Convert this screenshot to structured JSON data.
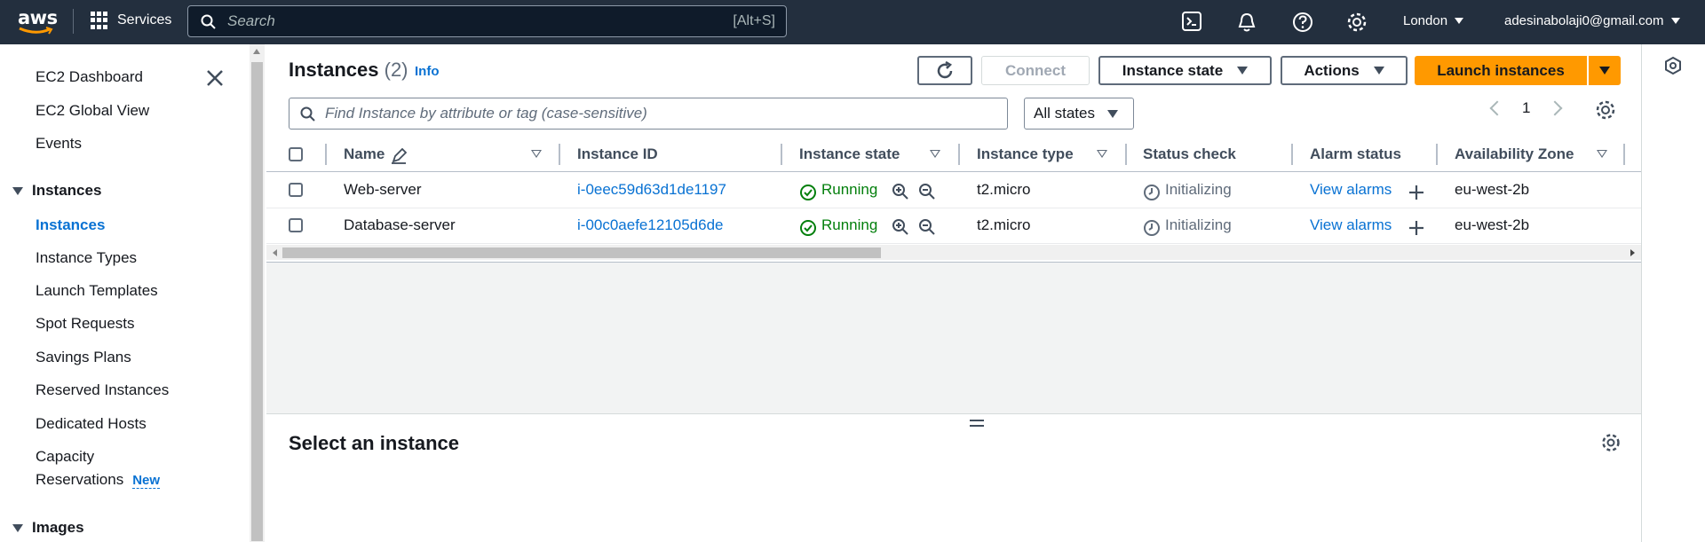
{
  "topnav": {
    "logo_text": "aws",
    "services_label": "Services",
    "search_placeholder": "Search",
    "search_shortcut": "[Alt+S]",
    "region": "London",
    "user": "adesinabolaji0@gmail.com"
  },
  "sidebar": {
    "items_top": [
      "EC2 Dashboard",
      "EC2 Global View",
      "Events"
    ],
    "section_instances": "Instances",
    "instances_items": [
      "Instances",
      "Instance Types",
      "Launch Templates",
      "Spot Requests",
      "Savings Plans",
      "Reserved Instances",
      "Dedicated Hosts",
      "Capacity"
    ],
    "capacity_line2": "Reservations",
    "new_badge": "New",
    "section_images": "Images"
  },
  "main": {
    "title": "Instances",
    "count": "(2)",
    "info": "Info",
    "buttons": {
      "connect": "Connect",
      "instance_state": "Instance state",
      "actions": "Actions",
      "launch": "Launch instances"
    },
    "filter_placeholder": "Find Instance by attribute or tag (case-sensitive)",
    "states_select": "All states",
    "page": "1",
    "columns": [
      "Name",
      "Instance ID",
      "Instance state",
      "Instance type",
      "Status check",
      "Alarm status",
      "Availability Zone"
    ],
    "rows": [
      {
        "name": "Web-server",
        "id": "i-0eec59d63d1de1197",
        "state": "Running",
        "type": "t2.micro",
        "status": "Initializing",
        "alarm": "View alarms",
        "az": "eu-west-2b"
      },
      {
        "name": "Database-server",
        "id": "i-00c0aefe12105d6de",
        "state": "Running",
        "type": "t2.micro",
        "status": "Initializing",
        "alarm": "View alarms",
        "az": "eu-west-2b"
      }
    ],
    "details_title": "Select an instance"
  },
  "colors": {
    "accent": "#ff9900",
    "link": "#0972d3",
    "running": "#037f0c",
    "nav": "#232f3e"
  }
}
